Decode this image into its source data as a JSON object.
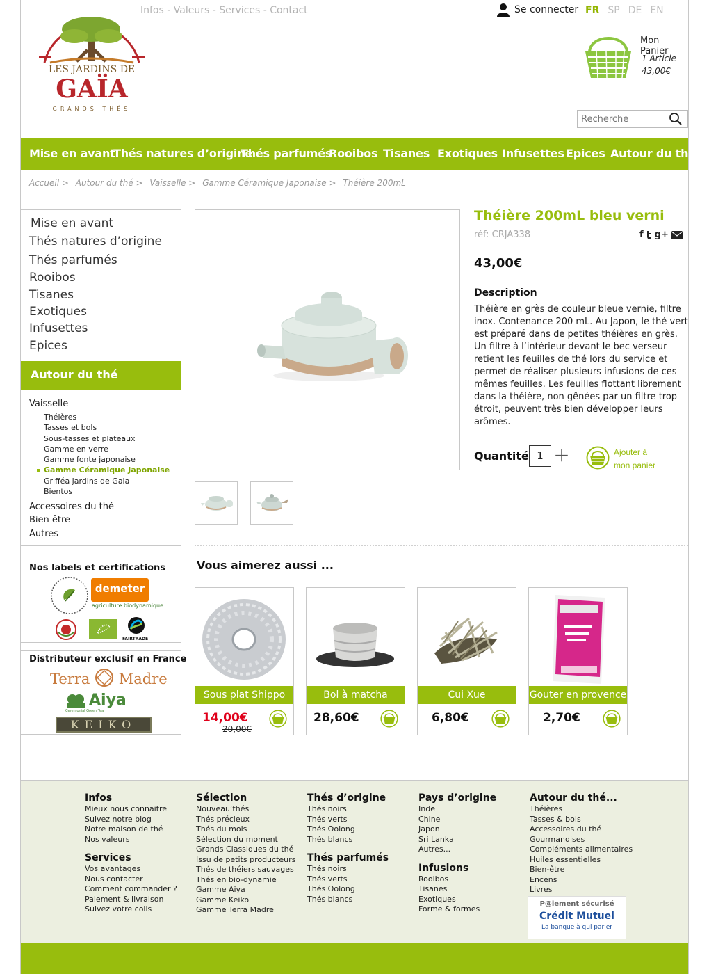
{
  "header": {
    "top_links": [
      "Infos",
      "Valeurs",
      "Services",
      "Contact"
    ],
    "login": "Se connecter",
    "languages": [
      "FR",
      "SP",
      "DE",
      "EN"
    ],
    "active_language": "FR",
    "logo": {
      "line1": "LES JARDINS DE",
      "line2": "GAÏA",
      "line3": "GRANDS THÉS"
    },
    "cart": {
      "title": "Mon Panier",
      "count": "1 Article",
      "total": "43,00€"
    },
    "search_placeholder": "Recherche"
  },
  "main_nav": [
    "Mise en avant",
    "Thés natures d’origine",
    "Thés parfumés",
    "Rooibos",
    "Tisanes",
    "Exotiques",
    "Infusettes",
    "Epices",
    "Autour du thé"
  ],
  "breadcrumb": [
    "Accueil >",
    "Autour du thé >",
    "Vaisselle >",
    "Gamme Céramique Japonaise >",
    "Théière 200mL"
  ],
  "sidebar": {
    "categories": [
      "Mise en avant",
      "Thés natures d’origine",
      "Thés parfumés",
      "Rooibos",
      "Tisanes",
      "Exotiques",
      "Infusettes",
      "Epices"
    ],
    "active_band": "Autour du thé",
    "subsections": {
      "vaisselle": "Vaisselle",
      "accessoires": "Accessoires du thé",
      "bien_etre": "Bien être",
      "autres": "Autres"
    },
    "vaisselle_items": [
      "Théières",
      "Tasses et bols",
      "Sous-tasses et plateaux",
      "Gamme en verre",
      "Gamme fonte japonaise",
      "Gamme Céramique Japonaise",
      "Grifféa jardins de Gaia",
      "Bientos"
    ],
    "selected_item": "Gamme Céramique Japonaise",
    "labels_title": "Nos labels et certifications",
    "labels": {
      "demeter": "demeter",
      "demeter_sub": "agriculture biodynamique",
      "fairtrade": "FAIRTRADE"
    },
    "distributor_title": "Distributeur exclusif en France",
    "brands": {
      "terra": "Terra",
      "madre": "Madre",
      "aiya": "Aiya",
      "aiya_sub": "Ceremonial Green Tea",
      "keiko": "KEIKO"
    }
  },
  "product": {
    "title": "Théière 200mL bleu verni",
    "ref": "réf: CRJA338",
    "price": "43,00€",
    "desc_title": "Description",
    "description": "Théière en grès de couleur bleue vernie, filtre inox. Contenance 200 mL. Au Japon, le thé vert est préparé dans de petites théières en grès. Un filtre à l’intérieur devant le bec verseur retient les feuilles de thé lors du service et permet de réaliser plusieurs infusions de ces mêmes feuilles. Les feuilles flottant librement dans la théière, non gênées par un filtre trop étroit, peuvent très bien développer leurs arômes.",
    "qty_label": "Quantité",
    "qty_value": "1",
    "add_to_cart": [
      "Ajouter à",
      "mon panier"
    ]
  },
  "also_like": {
    "title": "Vous aimerez aussi ...",
    "items": [
      {
        "name": "Sous plat Shippo",
        "price": "14,00€",
        "old_price": "20,00€"
      },
      {
        "name": "Bol à matcha",
        "price": "28,60€"
      },
      {
        "name": "Cui Xue",
        "price": "6,80€"
      },
      {
        "name": "Gouter en provence",
        "price": "2,70€"
      }
    ]
  },
  "footer": {
    "col1": {
      "title": "Infos",
      "items": [
        "Mieux nous connaitre",
        "Suivez notre blog",
        "Notre maison de thé",
        "Nos valeurs"
      ],
      "title2": "Services",
      "items2": [
        "Vos avantages",
        "Nous contacter",
        "Comment commander ?",
        "Paiement & livraison",
        "Suivez votre colis"
      ]
    },
    "col2": {
      "title": "Sélection",
      "items": [
        "Nouveau’thés",
        "Thés précieux",
        "Thés du mois",
        "Sélection du moment",
        "Grands Classiques du thé",
        "Issu de petits producteurs",
        "Thés de théiers sauvages",
        "Thés en bio-dynamie",
        "Gamme Aiya",
        "Gamme Keiko",
        "Gamme Terra Madre"
      ]
    },
    "col3": {
      "title": "Thés d’origine",
      "items": [
        "Thés noirs",
        "Thés verts",
        "Thés Oolong",
        "Thés blancs"
      ],
      "title2": "Thés parfumés",
      "items2": [
        "Thés noirs",
        "Thés verts",
        "Thés Oolong",
        "Thés blancs"
      ]
    },
    "col4": {
      "title": "Pays d’origine",
      "items": [
        "Inde",
        "Chine",
        "Japon",
        "Sri Lanka",
        "Autres..."
      ],
      "title2": "Infusions",
      "items2": [
        "Rooibos",
        "Tisanes",
        "Exotiques",
        "Forme & formes"
      ]
    },
    "col5": {
      "title": "Autour du thé...",
      "items": [
        "Théières",
        "Tasses & bols",
        "Accessoires du thé",
        "Gourmandises",
        "Compléments alimentaires",
        "Huiles essentielles",
        "Bien-être",
        "Encens",
        "Livres"
      ]
    },
    "payment": {
      "line1": "P@iement sécurisé",
      "line2": "Crédit Mutuel",
      "line3": "La banque à qui parler"
    }
  },
  "colors": {
    "accent": "#98bd0d",
    "promo": "#e0001b"
  }
}
